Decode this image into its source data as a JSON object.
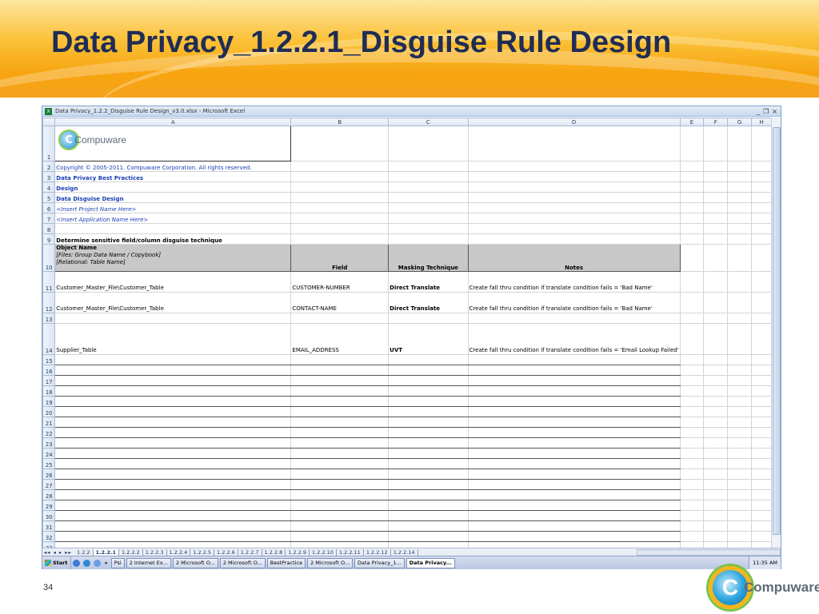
{
  "slide": {
    "title": "Data Privacy_1.2.2.1_Disguise Rule Design",
    "page_number": "34",
    "logo_text": "Compuware",
    "logo_initial": "C"
  },
  "excel": {
    "window_title": "Data Privacy_1.2.2_Disguise Rule Design_v3.0.xlsx - Microsoft Excel",
    "window_buttons": [
      "_",
      "❐",
      "×"
    ],
    "columns": [
      "A",
      "B",
      "C",
      "D",
      "E",
      "F",
      "G",
      "H"
    ],
    "logo_text": "Compuware",
    "logo_initial": "C",
    "rows_info": {
      "r2": "Copyright © 2005-2011. Compuware Corporation.  All rights reserved.",
      "r3": "Data Privacy Best Practices",
      "r4": "Design",
      "r5": "Data Disguise Design",
      "r6": "<Insert Project Name Here>",
      "r7": "<Insert Application Name Here>",
      "r9": "Determine sensitive field/column disguise technique"
    },
    "header": {
      "object_name": "Object Name",
      "object_line2": "[Files: Group Data Name / Copybook]",
      "object_line3": "[Relational: Table Name]",
      "field": "Field",
      "masking": "Masking Technique",
      "notes": "Notes"
    },
    "data_rows": [
      {
        "row": "11",
        "object": "Customer_Master_File\\Customer_Table",
        "field": "CUSTOMER-NUMBER",
        "masking": "Direct Translate",
        "notes": "Create fall thru condition if translate condition fails = 'Bad Name'"
      },
      {
        "row": "12",
        "object": "Customer_Master_File\\Customer_Table",
        "field": "CONTACT-NAME",
        "masking": "Direct Translate",
        "notes": "Create fall thru condition if translate condition fails = 'Bad Name'"
      },
      {
        "row": "14",
        "object": "Supplier_Table",
        "field": "EMAIL_ADDRESS",
        "masking": "UVT",
        "notes": "Create fall thru condition if translate condition fails = 'Email Lookup Failed'"
      }
    ],
    "row_numbers": [
      "1",
      "2",
      "3",
      "4",
      "5",
      "6",
      "7",
      "8",
      "9",
      "10",
      "11",
      "12",
      "13",
      "14",
      "15",
      "16",
      "17",
      "18",
      "19",
      "20",
      "21",
      "22",
      "23",
      "24",
      "25",
      "26",
      "27",
      "28",
      "29",
      "30",
      "31",
      "32",
      "33"
    ],
    "sheet_tabs": [
      "1.2.2",
      "1.2.2.1",
      "1.2.2.2",
      "1.2.2.3",
      "1.2.2.4",
      "1.2.2.5",
      "1.2.2.6",
      "1.2.2.7",
      "1.2.2.8",
      "1.2.2.9",
      "1.2.2.10",
      "1.2.2.11",
      "1.2.2.12",
      "1.2.2.14"
    ],
    "active_tab": "1.2.2.1",
    "sheet_nav": "◂◂ ◂ ▸ ▸▸"
  },
  "taskbar": {
    "start": "Start",
    "tasks": [
      {
        "label": "Psi",
        "active": false
      },
      {
        "label": "2 Internet Ex...",
        "active": false
      },
      {
        "label": "2 Microsoft O...",
        "active": false
      },
      {
        "label": "2 Microsoft O...",
        "active": false
      },
      {
        "label": "BestPractice",
        "active": false
      },
      {
        "label": "2 Microsoft O...",
        "active": false
      },
      {
        "label": "Data Privacy_1...",
        "active": false
      },
      {
        "label": "Data Privacy...",
        "active": true
      }
    ],
    "clock": "11:35 AM",
    "chevron": "»"
  }
}
